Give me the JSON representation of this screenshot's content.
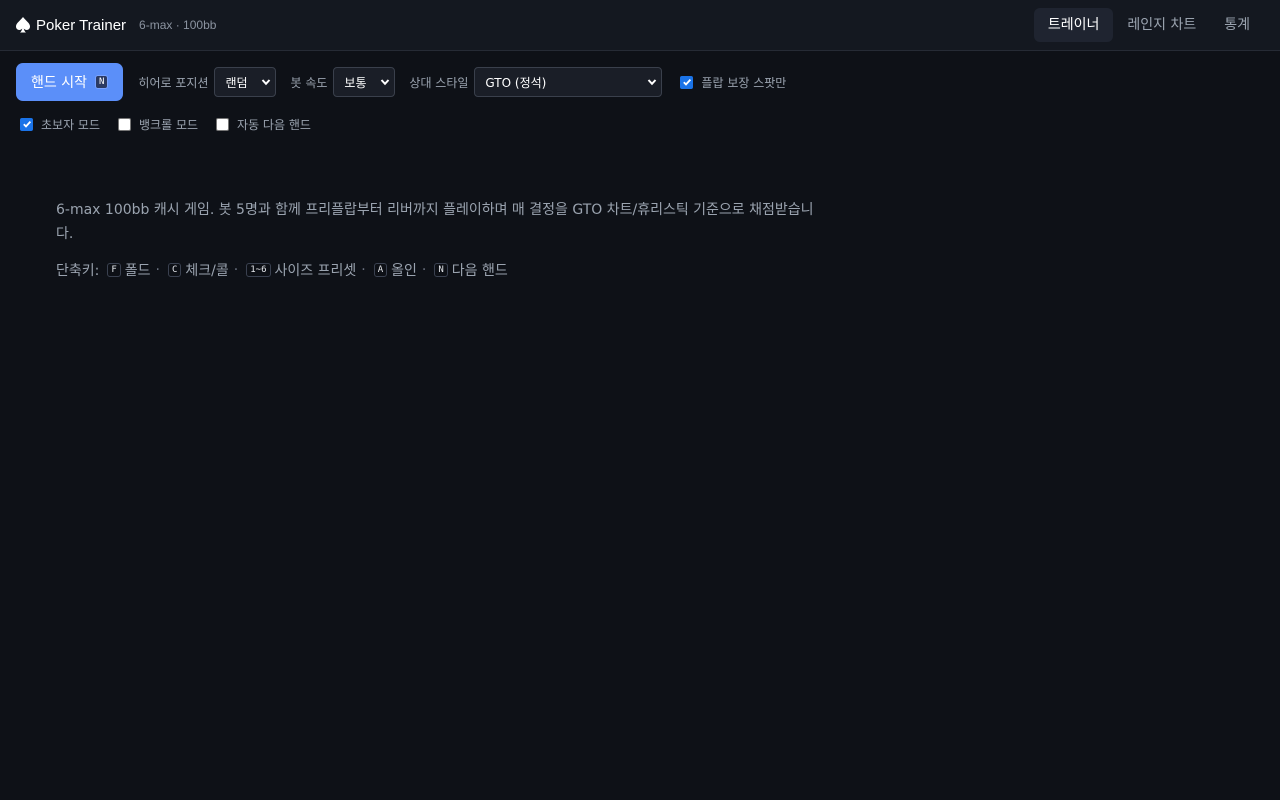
{
  "header": {
    "brand_icon": "spade-icon",
    "title": "Poker Trainer",
    "subtitle": "6-max · 100bb",
    "tabs": [
      {
        "label": "트레이너",
        "active": true
      },
      {
        "label": "레인지 차트",
        "active": false
      },
      {
        "label": "통계",
        "active": false
      }
    ]
  },
  "toolbar": {
    "start_label": "핸드 시작",
    "start_key": "N",
    "hero_position": {
      "label": "히어로 포지션",
      "value": "랜덤"
    },
    "bot_speed": {
      "label": "봇 속도",
      "value": "보통"
    },
    "opponent_style": {
      "label": "상대 스타일",
      "value": "GTO (정석)"
    },
    "flop_only": {
      "label": "플랍 보장 스팟만",
      "checked": true
    }
  },
  "options": {
    "beginner": {
      "label": "초보자 모드",
      "checked": true
    },
    "bankroll": {
      "label": "뱅크롤 모드",
      "checked": false
    },
    "auto_next": {
      "label": "자동 다음 핸드",
      "checked": false
    }
  },
  "intro": {
    "text": "6-max 100bb 캐시 게임. 봇 5명과 함께 프리플랍부터 리버까지 플레이하며 매 결정을 GTO 차트/휴리스틱 기준으로 채점받습니다.",
    "shortcuts_label": "단축키:",
    "shortcuts": [
      {
        "key": "F",
        "label": "폴드"
      },
      {
        "key": "C",
        "label": "체크/콜"
      },
      {
        "key": "1~6",
        "label": "사이즈 프리셋"
      },
      {
        "key": "A",
        "label": "올인"
      },
      {
        "key": "N",
        "label": "다음 핸드"
      }
    ]
  },
  "colors": {
    "accent": "#5b8ff9",
    "background": "#0e1117",
    "header_bg": "#141820",
    "checkbox_on": "#1a73e8"
  }
}
